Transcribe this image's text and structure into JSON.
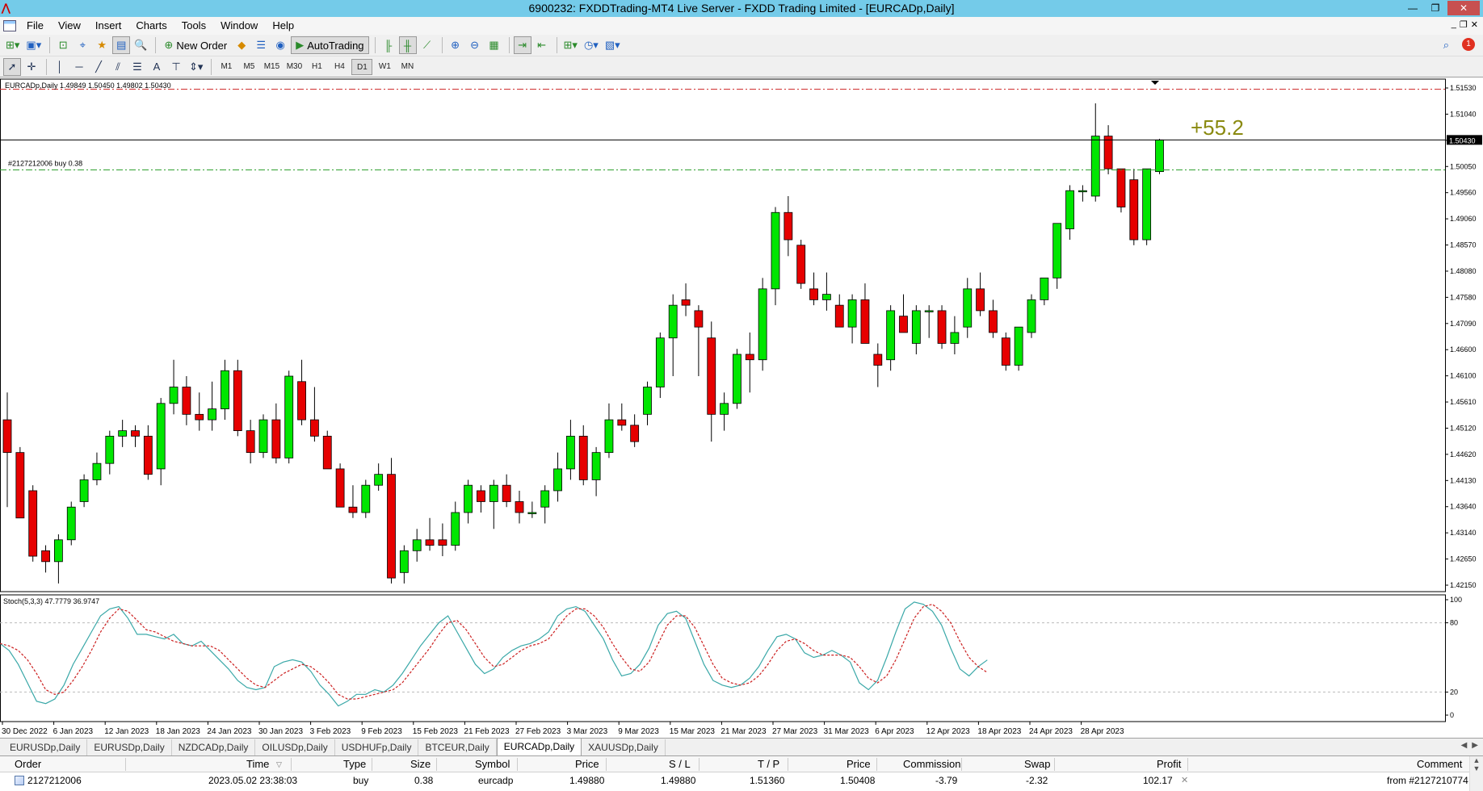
{
  "window": {
    "title": "6900232: FXDDTrading-MT4 Live Server - FXDD Trading Limited - [EURCADp,Daily]",
    "controls": {
      "minimize": "—",
      "maximize": "❐",
      "close": "✕"
    }
  },
  "menu": {
    "items": [
      "File",
      "View",
      "Insert",
      "Charts",
      "Tools",
      "Window",
      "Help"
    ],
    "child_controls": {
      "minimize": "_",
      "restore": "❐",
      "close": "✕"
    }
  },
  "toolbar": {
    "new_order_label": "New Order",
    "autotrading_label": "AutoTrading",
    "alerts_count": "1"
  },
  "timeframes": [
    "M1",
    "M5",
    "M15",
    "M30",
    "H1",
    "H4",
    "D1",
    "W1",
    "MN"
  ],
  "active_timeframe": "D1",
  "chart": {
    "header": "EURCADp,Daily  1.49849 1.50450 1.49802 1.50430",
    "order_label": "#2127212006 buy 0.38",
    "profit_overlay": "+55.2",
    "current_price_label": "1.50430",
    "price_axis_labels": [
      "1.51530",
      "1.51040",
      "1.50540",
      "1.50050",
      "1.49560",
      "1.49060",
      "1.48570",
      "1.48080",
      "1.47580",
      "1.47090",
      "1.46600",
      "1.46100",
      "1.45610",
      "1.45120",
      "1.44620",
      "1.44130",
      "1.43640",
      "1.43140",
      "1.42650",
      "1.42150"
    ],
    "colors": {
      "bull": "#00e600",
      "bear": "#e60000",
      "tp_line": "#d03030",
      "entry_line": "#30a030",
      "bid_line": "#000000",
      "stoch_main": "#3aa8a8",
      "stoch_signal": "#cc2020",
      "profit_text": "#8a8a10"
    }
  },
  "chart_data": {
    "type": "candlestick",
    "symbol": "EURCADp",
    "timeframe": "Daily",
    "ylim": [
      1.4215,
      1.5153
    ],
    "x_tick_labels": [
      "30 Dec 2022",
      "6 Jan 2023",
      "12 Jan 2023",
      "18 Jan 2023",
      "24 Jan 2023",
      "30 Jan 2023",
      "3 Feb 2023",
      "9 Feb 2023",
      "15 Feb 2023",
      "21 Feb 2023",
      "27 Feb 2023",
      "3 Mar 2023",
      "9 Mar 2023",
      "15 Mar 2023",
      "21 Mar 2023",
      "27 Mar 2023",
      "31 Mar 2023",
      "6 Apr 2023",
      "12 Apr 2023",
      "18 Apr 2023",
      "24 Apr 2023",
      "28 Apr 2023"
    ],
    "last_bar": {
      "open": 1.49849,
      "high": 1.5045,
      "low": 1.49802,
      "close": 1.5043
    },
    "take_profit": 1.5136,
    "entry_price": 1.4988,
    "candles": [
      [
        1.453,
        1.458,
        1.437,
        1.447
      ],
      [
        1.447,
        1.448,
        1.435,
        1.435
      ],
      [
        1.44,
        1.441,
        1.427,
        1.428
      ],
      [
        1.429,
        1.43,
        1.425,
        1.427
      ],
      [
        1.427,
        1.432,
        1.423,
        1.431
      ],
      [
        1.431,
        1.438,
        1.43,
        1.437
      ],
      [
        1.438,
        1.443,
        1.437,
        1.442
      ],
      [
        1.442,
        1.447,
        1.441,
        1.445
      ],
      [
        1.445,
        1.451,
        1.443,
        1.45
      ],
      [
        1.45,
        1.453,
        1.448,
        1.451
      ],
      [
        1.451,
        1.452,
        1.448,
        1.45
      ],
      [
        1.45,
        1.452,
        1.442,
        1.443
      ],
      [
        1.444,
        1.457,
        1.441,
        1.456
      ],
      [
        1.456,
        1.464,
        1.454,
        1.459
      ],
      [
        1.459,
        1.461,
        1.452,
        1.454
      ],
      [
        1.454,
        1.458,
        1.451,
        1.453
      ],
      [
        1.453,
        1.46,
        1.451,
        1.455
      ],
      [
        1.455,
        1.464,
        1.453,
        1.462
      ],
      [
        1.462,
        1.464,
        1.45,
        1.451
      ],
      [
        1.451,
        1.453,
        1.445,
        1.447
      ],
      [
        1.447,
        1.454,
        1.446,
        1.453
      ],
      [
        1.453,
        1.456,
        1.445,
        1.446
      ],
      [
        1.446,
        1.462,
        1.445,
        1.461
      ],
      [
        1.46,
        1.464,
        1.452,
        1.453
      ],
      [
        1.453,
        1.459,
        1.449,
        1.45
      ],
      [
        1.45,
        1.451,
        1.444,
        1.444
      ],
      [
        1.444,
        1.445,
        1.437,
        1.437
      ],
      [
        1.437,
        1.441,
        1.435,
        1.436
      ],
      [
        1.436,
        1.442,
        1.435,
        1.441
      ],
      [
        1.441,
        1.445,
        1.44,
        1.443
      ],
      [
        1.443,
        1.446,
        1.423,
        1.424
      ],
      [
        1.425,
        1.43,
        1.423,
        1.429
      ],
      [
        1.429,
        1.433,
        1.427,
        1.431
      ],
      [
        1.431,
        1.435,
        1.429,
        1.43
      ],
      [
        1.431,
        1.434,
        1.428,
        1.43
      ],
      [
        1.43,
        1.438,
        1.429,
        1.436
      ],
      [
        1.436,
        1.442,
        1.434,
        1.441
      ],
      [
        1.44,
        1.441,
        1.436,
        1.438
      ],
      [
        1.438,
        1.442,
        1.433,
        1.441
      ],
      [
        1.441,
        1.443,
        1.437,
        1.438
      ],
      [
        1.438,
        1.44,
        1.434,
        1.436
      ],
      [
        1.436,
        1.438,
        1.435,
        1.436
      ],
      [
        1.437,
        1.441,
        1.434,
        1.44
      ],
      [
        1.44,
        1.447,
        1.438,
        1.444
      ],
      [
        1.444,
        1.453,
        1.442,
        1.45
      ],
      [
        1.45,
        1.452,
        1.441,
        1.442
      ],
      [
        1.442,
        1.448,
        1.439,
        1.447
      ],
      [
        1.447,
        1.456,
        1.446,
        1.453
      ],
      [
        1.453,
        1.456,
        1.451,
        1.452
      ],
      [
        1.452,
        1.454,
        1.448,
        1.449
      ],
      [
        1.454,
        1.46,
        1.452,
        1.459
      ],
      [
        1.459,
        1.469,
        1.457,
        1.468
      ],
      [
        1.468,
        1.476,
        1.461,
        1.474
      ],
      [
        1.475,
        1.478,
        1.472,
        1.474
      ],
      [
        1.473,
        1.474,
        1.461,
        1.47
      ],
      [
        1.468,
        1.471,
        1.449,
        1.454
      ],
      [
        1.454,
        1.458,
        1.451,
        1.456
      ],
      [
        1.456,
        1.466,
        1.455,
        1.465
      ],
      [
        1.465,
        1.469,
        1.458,
        1.464
      ],
      [
        1.464,
        1.479,
        1.462,
        1.477
      ],
      [
        1.477,
        1.492,
        1.474,
        1.491
      ],
      [
        1.491,
        1.494,
        1.483,
        1.486
      ],
      [
        1.485,
        1.486,
        1.477,
        1.478
      ],
      [
        1.477,
        1.48,
        1.474,
        1.475
      ],
      [
        1.475,
        1.48,
        1.473,
        1.476
      ],
      [
        1.474,
        1.476,
        1.47,
        1.47
      ],
      [
        1.47,
        1.476,
        1.467,
        1.475
      ],
      [
        1.475,
        1.478,
        1.467,
        1.467
      ],
      [
        1.465,
        1.467,
        1.459,
        1.463
      ],
      [
        1.464,
        1.474,
        1.462,
        1.473
      ],
      [
        1.472,
        1.476,
        1.469,
        1.469
      ],
      [
        1.467,
        1.474,
        1.465,
        1.473
      ],
      [
        1.473,
        1.474,
        1.468,
        1.473
      ],
      [
        1.473,
        1.474,
        1.466,
        1.467
      ],
      [
        1.467,
        1.472,
        1.465,
        1.469
      ],
      [
        1.47,
        1.479,
        1.468,
        1.477
      ],
      [
        1.477,
        1.48,
        1.472,
        1.473
      ],
      [
        1.473,
        1.475,
        1.468,
        1.469
      ],
      [
        1.468,
        1.469,
        1.462,
        1.463
      ],
      [
        1.463,
        1.47,
        1.462,
        1.47
      ],
      [
        1.469,
        1.476,
        1.468,
        1.475
      ],
      [
        1.475,
        1.479,
        1.474,
        1.479
      ],
      [
        1.479,
        1.489,
        1.477,
        1.489
      ],
      [
        1.488,
        1.496,
        1.486,
        1.495
      ],
      [
        1.495,
        1.496,
        1.493,
        1.495
      ],
      [
        1.494,
        1.511,
        1.493,
        1.505
      ],
      [
        1.505,
        1.507,
        1.498,
        1.499
      ],
      [
        1.499,
        1.499,
        1.491,
        1.492
      ],
      [
        1.497,
        1.499,
        1.485,
        1.486
      ],
      [
        1.486,
        1.499,
        1.485,
        1.499
      ],
      [
        1.49849,
        1.5045,
        1.49802,
        1.5043
      ]
    ],
    "stochastic": {
      "label": "Stoch(5,3,3) 47.7779 36.9747",
      "ylim": [
        0,
        100
      ],
      "levels": [
        80,
        20
      ],
      "axis_labels": [
        "100",
        "80",
        "20",
        "0"
      ],
      "main": [
        62,
        56,
        44,
        28,
        12,
        10,
        14,
        26,
        44,
        58,
        72,
        86,
        92,
        94,
        84,
        70,
        70,
        68,
        66,
        70,
        62,
        60,
        64,
        56,
        48,
        40,
        30,
        24,
        22,
        24,
        42,
        46,
        48,
        46,
        38,
        26,
        18,
        8,
        12,
        18,
        18,
        22,
        20,
        26,
        36,
        48,
        60,
        70,
        80,
        86,
        72,
        58,
        44,
        36,
        40,
        50,
        56,
        60,
        62,
        66,
        72,
        86,
        92,
        94,
        90,
        78,
        66,
        48,
        34,
        36,
        44,
        58,
        78,
        88,
        90,
        84,
        64,
        44,
        30,
        26,
        24,
        26,
        32,
        42,
        56,
        68,
        70,
        66,
        54,
        50,
        52,
        56,
        52,
        46,
        28,
        22,
        30,
        50,
        72,
        92,
        98,
        96,
        90,
        78,
        58,
        40,
        34,
        42,
        47.78
      ],
      "signal": [
        62,
        60,
        56,
        48,
        36,
        22,
        18,
        20,
        30,
        42,
        56,
        72,
        84,
        92,
        90,
        82,
        74,
        72,
        68,
        64,
        62,
        60,
        60,
        60,
        56,
        48,
        40,
        32,
        26,
        24,
        30,
        36,
        40,
        44,
        42,
        36,
        28,
        18,
        14,
        14,
        16,
        18,
        20,
        22,
        28,
        38,
        48,
        58,
        70,
        80,
        82,
        74,
        62,
        50,
        42,
        44,
        50,
        56,
        60,
        62,
        66,
        76,
        86,
        92,
        92,
        86,
        76,
        62,
        50,
        40,
        38,
        46,
        62,
        78,
        86,
        86,
        76,
        60,
        44,
        32,
        28,
        26,
        28,
        34,
        44,
        56,
        64,
        66,
        62,
        56,
        52,
        52,
        52,
        50,
        42,
        32,
        28,
        34,
        48,
        66,
        84,
        94,
        96,
        90,
        80,
        64,
        50,
        42,
        36.97
      ]
    }
  },
  "symbol_tabs": [
    "EURUSDp,Daily",
    "EURUSDp,Daily",
    "NZDCADp,Daily",
    "OILUSDp,Daily",
    "USDHUFp,Daily",
    "BTCEUR,Daily",
    "EURCADp,Daily",
    "XAUUSDp,Daily"
  ],
  "active_symbol_tab": "EURCADp,Daily",
  "terminal": {
    "columns": [
      "Order",
      "Time",
      "Type",
      "Size",
      "Symbol",
      "Price",
      "S / L",
      "T / P",
      "Price",
      "Commission",
      "Swap",
      "Profit",
      "Comment"
    ],
    "rows": [
      {
        "order": "2127212006",
        "time": "2023.05.02 23:38:03",
        "type": "buy",
        "size": "0.38",
        "symbol": "eurcadp",
        "price": "1.49880",
        "sl": "1.49880",
        "tp": "1.51360",
        "current_price": "1.50408",
        "commission": "-3.79",
        "swap": "-2.32",
        "profit": "102.17",
        "comment": "from #2127210774"
      }
    ]
  }
}
